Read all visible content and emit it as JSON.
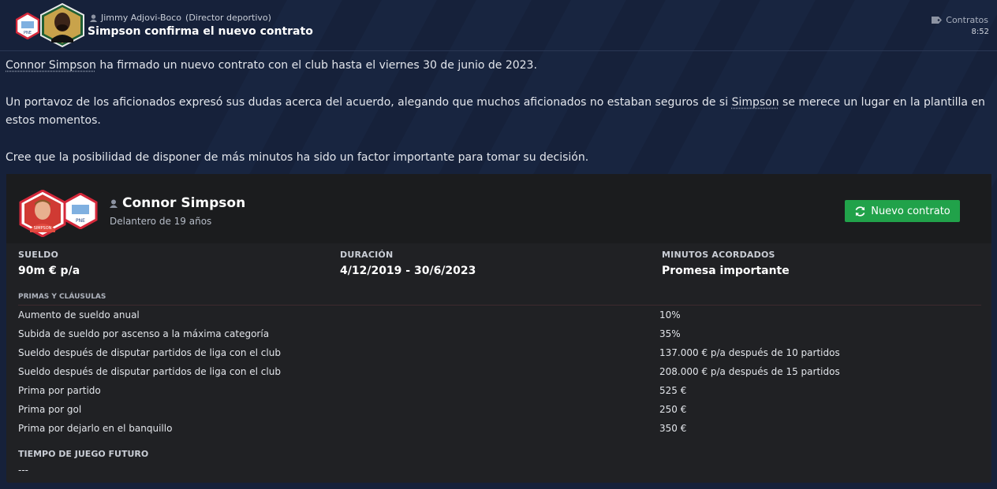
{
  "header": {
    "sender_name": "Jimmy Adjovi-Boco",
    "sender_role": "(Director deportivo)",
    "subject": "Simpson confirma el nuevo contrato",
    "category": "Contratos",
    "time": "8:52"
  },
  "body": {
    "p1_link": "Connor Simpson",
    "p1_rest": " ha firmado un nuevo contrato con el club hasta el viernes 30 de junio de 2023.",
    "p2_start": "Un portavoz de los aficionados expresó sus dudas acerca del acuerdo, alegando que muchos aficionados no estaban seguros de si ",
    "p2_link": "Simpson",
    "p2_end": " se merece un lugar en la plantilla en estos momentos.",
    "p3": "Cree que la posibilidad de disponer de más minutos ha sido un factor importante para tomar su decisión."
  },
  "player": {
    "name": "Connor Simpson",
    "description": "Delantero de 19 años",
    "contract_button": "Nuevo contrato"
  },
  "contract": {
    "salary_label": "SUELDO",
    "salary_value": "90m € p/a",
    "duration_label": "DURACIÓN",
    "duration_value": "4/12/2019 - 30/6/2023",
    "minutes_label": "MINUTOS ACORDADOS",
    "minutes_value": "Promesa importante",
    "bonuses_title": "PRIMAS Y CLÁUSULAS",
    "bonuses": [
      {
        "label": "Aumento de sueldo anual",
        "value": "10%"
      },
      {
        "label": "Subida de sueldo por ascenso a la máxima categoría",
        "value": "35%"
      },
      {
        "label": "Sueldo después de disputar partidos de liga con el club",
        "value": "137.000 € p/a después de 10 partidos"
      },
      {
        "label": "Sueldo después de disputar partidos de liga con el club",
        "value": "208.000 € p/a después de 15 partidos"
      },
      {
        "label": "Prima por partido",
        "value": "525 €"
      },
      {
        "label": "Prima por gol",
        "value": "250 €"
      },
      {
        "label": "Prima por dejarlo en el banquillo",
        "value": "350 €"
      }
    ],
    "future_title": "TIEMPO DE JUEGO FUTURO",
    "future_value": "---"
  },
  "colors": {
    "background": "#16213a",
    "card": "#202124",
    "accent_green": "#21a24a"
  }
}
